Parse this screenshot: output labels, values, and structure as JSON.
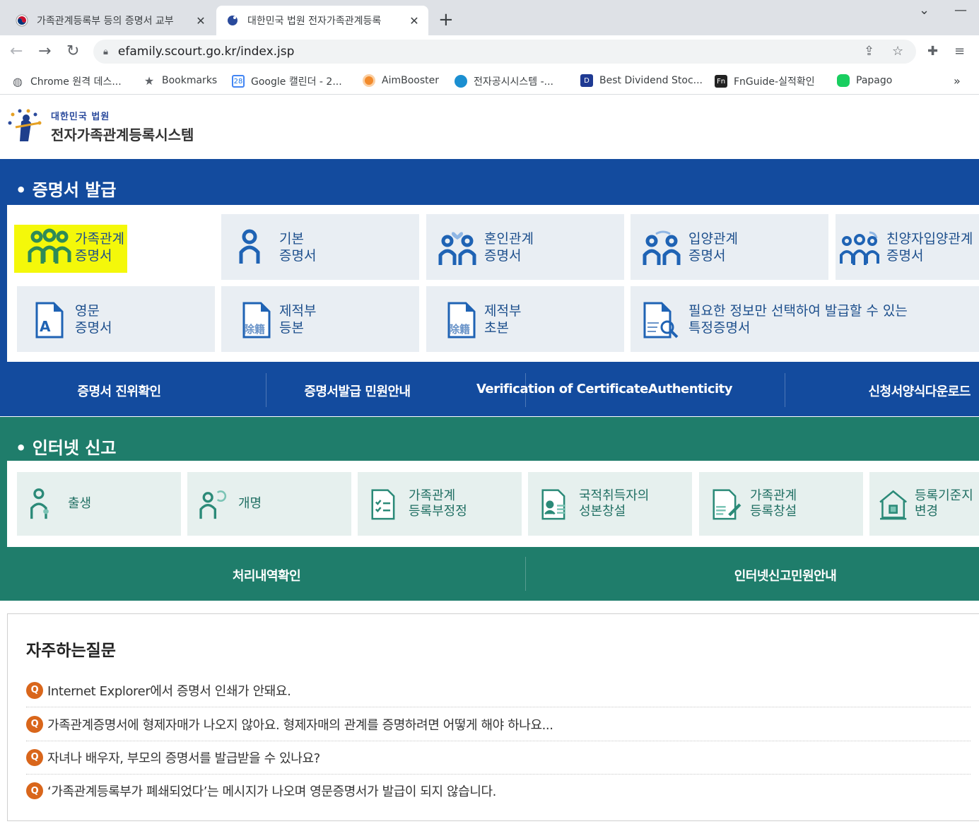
{
  "browser": {
    "tabs": [
      {
        "title": "가족관계등록부 등의 증명서 교부",
        "active": false
      },
      {
        "title": "대한민국 법원 전자가족관계등록",
        "active": true
      }
    ],
    "new_tab": "+",
    "url": "efamily.scourt.go.kr/index.jsp",
    "bookmarks": [
      {
        "label": "Chrome 원격 데스...",
        "icon": "globe-icon"
      },
      {
        "label": "Bookmarks",
        "icon": "star-icon"
      },
      {
        "label": "Google 캘린더 - 2...",
        "icon": "calendar-icon",
        "icon_text": "28"
      },
      {
        "label": "AimBooster",
        "icon": "target-icon"
      },
      {
        "label": "전자공시시스템 -...",
        "icon": "dart-icon"
      },
      {
        "label": "Best Dividend Stoc...",
        "icon": "d-icon",
        "icon_text": "D"
      },
      {
        "label": "FnGuide-실적확인",
        "icon": "fn-icon",
        "icon_text": "Fn"
      },
      {
        "label": "Papago",
        "icon": "papago-icon"
      }
    ],
    "more": "»"
  },
  "site": {
    "logo_line1": "대한민국 법원",
    "logo_line2": "전자가족관계등록시스템"
  },
  "cert": {
    "title": "• 증명서 발급",
    "row1": [
      {
        "l1": "가족관계",
        "l2": "증명서"
      },
      {
        "l1": "기본",
        "l2": "증명서"
      },
      {
        "l1": "혼인관계",
        "l2": "증명서"
      },
      {
        "l1": "입양관계",
        "l2": "증명서"
      },
      {
        "l1": "친양자입양관계",
        "l2": "증명서"
      }
    ],
    "row2": [
      {
        "l1": "영문",
        "l2": "증명서"
      },
      {
        "l1": "제적부",
        "l2": "등본"
      },
      {
        "l1": "제적부",
        "l2": "초본"
      },
      {
        "l1": "필요한 정보만 선택하여 발급할 수 있는",
        "l2": "특정증명서"
      }
    ],
    "icon_text": {
      "a": "A",
      "hanja": "除籍"
    },
    "links": [
      "증명서 진위확인",
      "증명서발급 민원안내",
      "Verification of CertificateAuthenticity",
      "신청서양식다운로드"
    ]
  },
  "report": {
    "title": "• 인터넷 신고",
    "items": [
      {
        "l1": "출생",
        "l2": ""
      },
      {
        "l1": "개명",
        "l2": ""
      },
      {
        "l1": "가족관계",
        "l2": "등록부정정"
      },
      {
        "l1": "국적취득자의",
        "l2": "성본창설"
      },
      {
        "l1": "가족관계",
        "l2": "등록창설"
      },
      {
        "l1": "등록기준지",
        "l2": "변경"
      }
    ],
    "links": [
      "처리내역확인",
      "인터넷신고민원안내"
    ]
  },
  "faq": {
    "title": "자주하는질문",
    "badge": "Q",
    "items": [
      "Internet Explorer에서 증명서 인쇄가 안돼요.",
      "가족관계증명서에 형제자매가 나오지 않아요. 형제자매의 관계를 증명하려면 어떻게 해야 하나요...",
      "자녀나 배우자, 부모의 증명서를 발급받을 수 있나요?",
      "‘가족관계등록부가 폐쇄되었다’는 메시지가 나오며 영문증명서가 발급이 되지 않습니다."
    ]
  },
  "colors": {
    "blue_section": "#134b9e",
    "green_section": "#1f7d6b",
    "highlight": "#f4f80a",
    "faq_badge": "#d9661b"
  }
}
